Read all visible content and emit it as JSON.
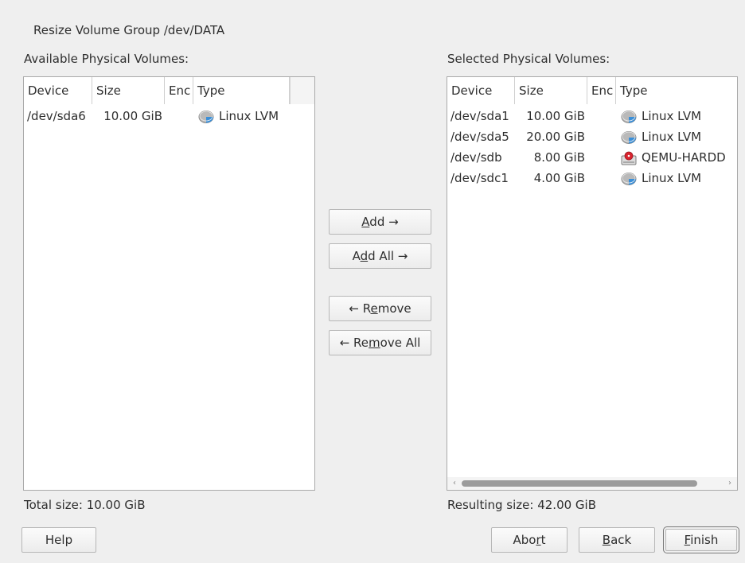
{
  "dialog": {
    "title": "Resize Volume Group /dev/DATA"
  },
  "available": {
    "label": "Available Physical Volumes:",
    "columns": [
      "Device",
      "Size",
      "Enc",
      "Type"
    ],
    "rows": [
      {
        "device": "/dev/sda6",
        "size": "10.00 GiB",
        "enc": "",
        "type": "Linux LVM",
        "icon": "lvm-disk-icon"
      }
    ],
    "total": "Total size: 10.00 GiB"
  },
  "selected": {
    "label": "Selected Physical Volumes:",
    "columns": [
      "Device",
      "Size",
      "Enc",
      "Type"
    ],
    "rows": [
      {
        "device": "/dev/sda1",
        "size": "10.00 GiB",
        "enc": "",
        "type": "Linux LVM",
        "icon": "lvm-disk-icon"
      },
      {
        "device": "/dev/sda5",
        "size": "20.00 GiB",
        "enc": "",
        "type": "Linux LVM",
        "icon": "lvm-disk-icon"
      },
      {
        "device": "/dev/sdb",
        "size": "8.00 GiB",
        "enc": "",
        "type": "QEMU-HARDD",
        "icon": "hard-disk-icon"
      },
      {
        "device": "/dev/sdc1",
        "size": "4.00 GiB",
        "enc": "",
        "type": "Linux LVM",
        "icon": "lvm-disk-icon"
      }
    ],
    "resulting": "Resulting size: 42.00 GiB"
  },
  "actions": {
    "add": {
      "pre": "",
      "mn": "A",
      "post": "dd →"
    },
    "add_all": {
      "pre": "A",
      "mn": "d",
      "post": "d All →"
    },
    "remove": {
      "pre": "← R",
      "mn": "e",
      "post": "move"
    },
    "remove_all": {
      "pre": "← Re",
      "mn": "m",
      "post": "ove All"
    }
  },
  "footer": {
    "help": "Help",
    "abort": {
      "pre": "Abo",
      "mn": "r",
      "post": "t"
    },
    "back": {
      "pre": "",
      "mn": "B",
      "post": "ack"
    },
    "finish": {
      "pre": "",
      "mn": "F",
      "post": "inish"
    }
  },
  "colors": {
    "lvm_icon": "#3a8fd9",
    "disk_icon_red": "#d9232e"
  }
}
